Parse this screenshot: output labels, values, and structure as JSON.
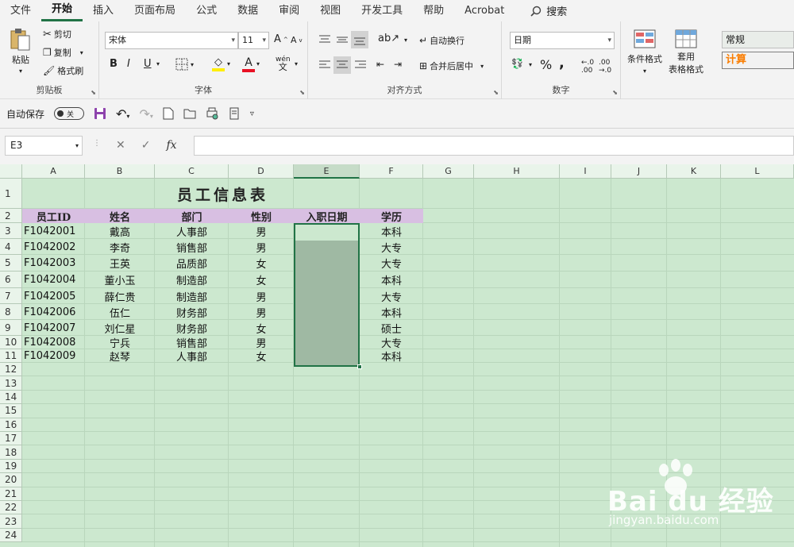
{
  "menu": [
    "文件",
    "开始",
    "插入",
    "页面布局",
    "公式",
    "数据",
    "审阅",
    "视图",
    "开发工具",
    "帮助",
    "Acrobat"
  ],
  "search_label": "搜索",
  "ribbon": {
    "clipboard": {
      "paste": "粘贴",
      "cut": "剪切",
      "copy": "复制",
      "format_painter": "格式刷",
      "label": "剪贴板"
    },
    "font": {
      "font_name": "宋体",
      "font_size": "11",
      "bold": "B",
      "italic": "I",
      "underline": "U",
      "label": "字体"
    },
    "alignment": {
      "wrap_text": "自动换行",
      "merge_center": "合并后居中",
      "label": "对齐方式"
    },
    "number": {
      "format": "日期",
      "percent": "%",
      "comma": ",",
      "label": "数字"
    },
    "styles": {
      "conditional": "条件格式",
      "table_format_1": "套用",
      "table_format_2": "表格格式",
      "style_normal": "常规",
      "style_calc": "计算"
    }
  },
  "qat": {
    "autosave": "自动保存",
    "toggle_state": "关"
  },
  "namebox": "E3",
  "fx_label": "fx",
  "columns": [
    "A",
    "B",
    "C",
    "D",
    "E",
    "F",
    "G",
    "H",
    "I",
    "J",
    "K",
    "L"
  ],
  "rows": [
    "1",
    "2",
    "3",
    "4",
    "5",
    "6",
    "7",
    "8",
    "9",
    "10",
    "11",
    "12",
    "13",
    "14",
    "15",
    "16",
    "17",
    "18",
    "19",
    "20",
    "21",
    "22",
    "23",
    "24"
  ],
  "sheet": {
    "title": "员工信息表",
    "headers": [
      "员工ID",
      "姓名",
      "部门",
      "性别",
      "入职日期",
      "学历"
    ],
    "data": [
      [
        "F1042001",
        "戴高",
        "人事部",
        "男",
        "",
        "本科"
      ],
      [
        "F1042002",
        "李奇",
        "销售部",
        "男",
        "",
        "大专"
      ],
      [
        "F1042003",
        "王英",
        "品质部",
        "女",
        "",
        "大专"
      ],
      [
        "F1042004",
        "董小玉",
        "制造部",
        "女",
        "",
        "本科"
      ],
      [
        "F1042005",
        "薛仁贵",
        "制造部",
        "男",
        "",
        "大专"
      ],
      [
        "F1042006",
        "伍仁",
        "财务部",
        "男",
        "",
        "本科"
      ],
      [
        "F1042007",
        "刘仁星",
        "财务部",
        "女",
        "",
        "硕士"
      ],
      [
        "F1042008",
        "宁兵",
        "销售部",
        "男",
        "",
        "大专"
      ],
      [
        "F1042009",
        "赵琴",
        "人事部",
        "女",
        "",
        "本科"
      ]
    ]
  },
  "watermark": {
    "brand": "Bai du 经验",
    "url": "jingyan.baidu.com"
  },
  "colors": {
    "accent": "#217346",
    "sheet_bg": "#cce8cf",
    "header_bg": "#d8bfe2",
    "selection": "#9fb9a3"
  }
}
